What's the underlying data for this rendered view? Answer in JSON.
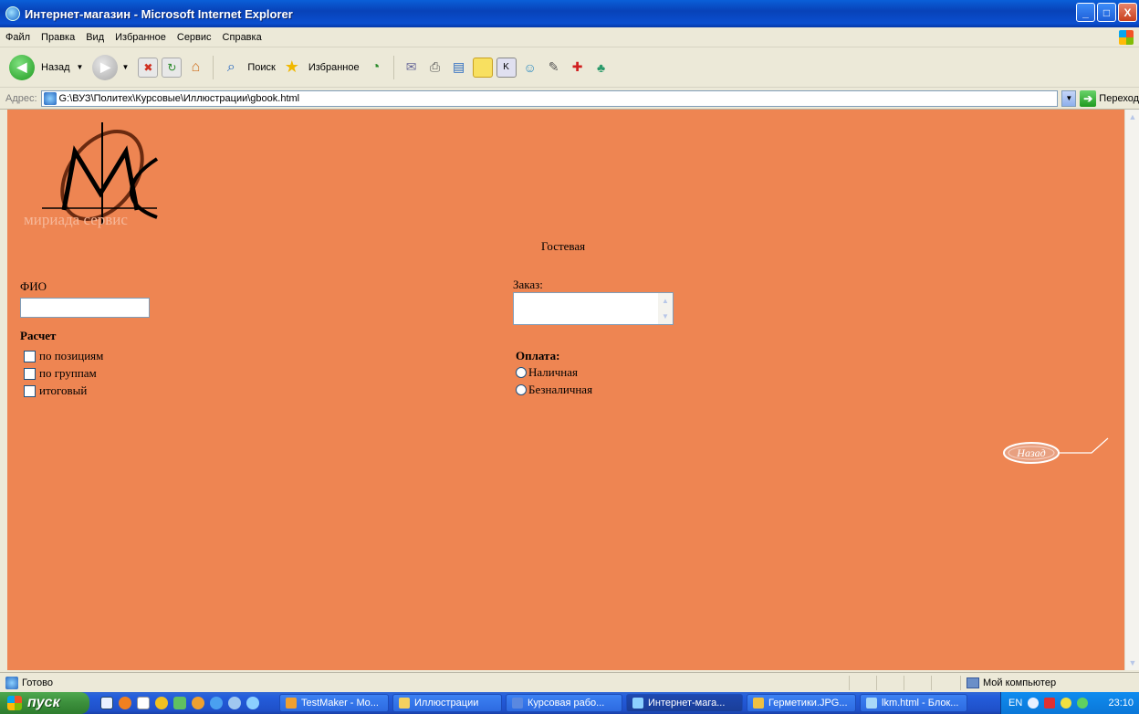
{
  "window": {
    "title": "Интернет-магазин - Microsoft Internet Explorer",
    "buttons": {
      "minimize": "_",
      "maximize": "□",
      "close": "X"
    }
  },
  "menu": [
    "Файл",
    "Правка",
    "Вид",
    "Избранное",
    "Сервис",
    "Справка"
  ],
  "toolbar": {
    "back": "Назад",
    "search": "Поиск",
    "favorites": "Избранное"
  },
  "address": {
    "label": "Адрес:",
    "url": "G:\\ВУЗ\\Политех\\Курсовые\\Иллюстрации\\gbook.html",
    "go": "Переход"
  },
  "page": {
    "logo_text": "мириада сервис",
    "heading": "Гостевая",
    "fio_label": "ФИО",
    "fio_value": "",
    "calc_title": "Расчет",
    "calc_options": [
      "по позициям",
      "по группам",
      "итоговый"
    ],
    "order_label": "Заказ:",
    "pay_title": "Оплата:",
    "pay_options": [
      "Наличная",
      "Безналичная"
    ],
    "back_label": "Назад",
    "colors": {
      "background": "#ee8552",
      "logo": "#000000"
    }
  },
  "status": {
    "text": "Готово",
    "zone": "Мой компьютер"
  },
  "taskbar": {
    "start": "пуск",
    "tasks": [
      {
        "label": "TestMaker - Mo...",
        "color": "#f0a030"
      },
      {
        "label": "Иллюстрации",
        "color": "#f3d060"
      },
      {
        "label": "Курсовая рабо...",
        "color": "#5a88e0"
      },
      {
        "label": "Интернет-мага...",
        "color": "#8cd0ff",
        "active": true
      },
      {
        "label": "Герметики.JPG...",
        "color": "#f0c040"
      },
      {
        "label": "lkm.html - Блок...",
        "color": "#a8d8f8"
      }
    ],
    "lang": "EN",
    "clock": "23:10"
  }
}
